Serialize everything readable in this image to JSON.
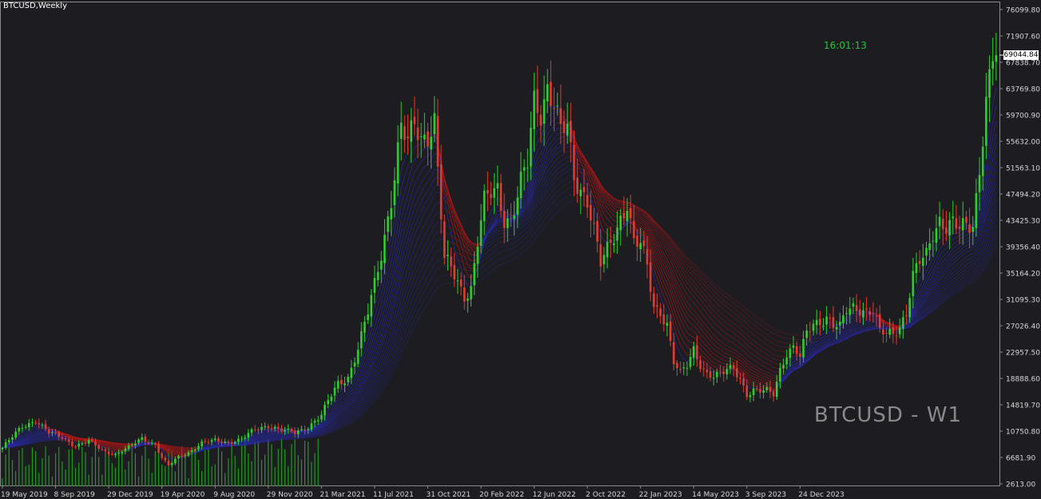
{
  "header": {
    "symbol": "BTCUSD,Weekly"
  },
  "timer": "16:01:13",
  "watermark": "BTCUSD - W1",
  "current_price_label": "69044.84",
  "colors": {
    "background": "#1c1c21",
    "bull": "#2bd12b",
    "bear": "#e03c2f",
    "ribbon_up": "#2a2aa8",
    "ribbon_down": "#a81818",
    "volume": "#1f9a1f",
    "axis_text": "#d8d8d8"
  },
  "chart_data": {
    "type": "candlestick",
    "title": "BTCUSD,Weekly",
    "price_axis_ticks": [
      "76099.80",
      "71907.60",
      "67838.70",
      "63769.80",
      "59700.90",
      "55632.00",
      "51563.10",
      "47494.20",
      "43425.30",
      "39356.40",
      "35164.20",
      "31095.30",
      "27026.40",
      "22957.50",
      "18888.60",
      "14819.70",
      "10750.80",
      "6681.90",
      "2613.00"
    ],
    "date_axis_ticks": [
      "19 May 2019",
      "8 Sep 2019",
      "29 Dec 2019",
      "19 Apr 2020",
      "9 Aug 2020",
      "29 Nov 2020",
      "21 Mar 2021",
      "11 Jul 2021",
      "31 Oct 2021",
      "20 Feb 2022",
      "12 Jun 2022",
      "2 Oct 2022",
      "22 Jan 2023",
      "14 May 2023",
      "3 Sep 2023",
      "24 Dec 2023"
    ],
    "ylim": [
      2613,
      77100
    ],
    "bars_per_tick": 16,
    "close_path_points": [
      [
        0,
        8200
      ],
      [
        6,
        11500
      ],
      [
        10,
        12500
      ],
      [
        14,
        10500
      ],
      [
        18,
        9800
      ],
      [
        22,
        8500
      ],
      [
        26,
        9200
      ],
      [
        30,
        7800
      ],
      [
        34,
        7200
      ],
      [
        38,
        8200
      ],
      [
        42,
        9700
      ],
      [
        46,
        8700
      ],
      [
        48,
        6600
      ],
      [
        50,
        5400
      ],
      [
        53,
        6800
      ],
      [
        56,
        7500
      ],
      [
        60,
        8900
      ],
      [
        64,
        9300
      ],
      [
        68,
        9100
      ],
      [
        72,
        9500
      ],
      [
        76,
        11000
      ],
      [
        80,
        11700
      ],
      [
        84,
        10900
      ],
      [
        88,
        10500
      ],
      [
        92,
        11500
      ],
      [
        96,
        13200
      ],
      [
        98,
        15300
      ],
      [
        101,
        18200
      ],
      [
        104,
        19200
      ],
      [
        107,
        23500
      ],
      [
        110,
        29000
      ],
      [
        112,
        33500
      ],
      [
        114,
        38500
      ],
      [
        117,
        47000
      ],
      [
        120,
        57500
      ],
      [
        122,
        55000
      ],
      [
        124,
        58500
      ],
      [
        126,
        56500
      ],
      [
        128,
        57000
      ],
      [
        130,
        59000
      ],
      [
        131,
        51000
      ],
      [
        133,
        37000
      ],
      [
        135,
        36000
      ],
      [
        137,
        34000
      ],
      [
        139,
        32000
      ],
      [
        141,
        33000
      ],
      [
        143,
        40000
      ],
      [
        145,
        46000
      ],
      [
        147,
        47500
      ],
      [
        149,
        48500
      ],
      [
        151,
        44000
      ],
      [
        153,
        43500
      ],
      [
        155,
        47000
      ],
      [
        156,
        49000
      ],
      [
        158,
        52000
      ],
      [
        160,
        62000
      ],
      [
        162,
        60500
      ],
      [
        164,
        64500
      ],
      [
        166,
        61500
      ],
      [
        168,
        57000
      ],
      [
        170,
        57500
      ],
      [
        172,
        50000
      ],
      [
        174,
        48500
      ],
      [
        176,
        47000
      ],
      [
        178,
        42000
      ],
      [
        180,
        36500
      ],
      [
        182,
        38500
      ],
      [
        184,
        41000
      ],
      [
        186,
        44000
      ],
      [
        188,
        46500
      ],
      [
        190,
        40000
      ],
      [
        192,
        39500
      ],
      [
        194,
        36000
      ],
      [
        196,
        30000
      ],
      [
        198,
        29500
      ],
      [
        200,
        27500
      ],
      [
        202,
        21500
      ],
      [
        204,
        19500
      ],
      [
        206,
        20800
      ],
      [
        208,
        23500
      ],
      [
        210,
        21300
      ],
      [
        212,
        19800
      ],
      [
        214,
        19200
      ],
      [
        216,
        19300
      ],
      [
        218,
        20200
      ],
      [
        220,
        20700
      ],
      [
        222,
        19100
      ],
      [
        224,
        16500
      ],
      [
        226,
        16900
      ],
      [
        228,
        16800
      ],
      [
        230,
        17000
      ],
      [
        232,
        16700
      ],
      [
        234,
        20500
      ],
      [
        236,
        22900
      ],
      [
        238,
        23500
      ],
      [
        240,
        22100
      ],
      [
        242,
        26000
      ],
      [
        244,
        27600
      ],
      [
        246,
        28000
      ],
      [
        248,
        28400
      ],
      [
        250,
        27000
      ],
      [
        252,
        26600
      ],
      [
        254,
        29500
      ],
      [
        256,
        30200
      ],
      [
        258,
        30000
      ],
      [
        260,
        29300
      ],
      [
        262,
        29100
      ],
      [
        264,
        26000
      ],
      [
        266,
        25900
      ],
      [
        268,
        26200
      ],
      [
        270,
        27200
      ],
      [
        272,
        29300
      ],
      [
        274,
        34500
      ],
      [
        276,
        36800
      ],
      [
        278,
        38000
      ],
      [
        280,
        41900
      ],
      [
        282,
        43800
      ],
      [
        284,
        42500
      ],
      [
        286,
        42700
      ],
      [
        288,
        41800
      ],
      [
        290,
        42600
      ],
      [
        292,
        43000
      ],
      [
        294,
        51800
      ],
      [
        296,
        62000
      ],
      [
        298,
        68300
      ],
      [
        299,
        69044.84
      ]
    ],
    "ribbon_periods": [
      5,
      7,
      9,
      11,
      13,
      15,
      17,
      19,
      21,
      23,
      26,
      29,
      32,
      35,
      38,
      42,
      46,
      50,
      55,
      60
    ],
    "last_close": 69044.84
  }
}
